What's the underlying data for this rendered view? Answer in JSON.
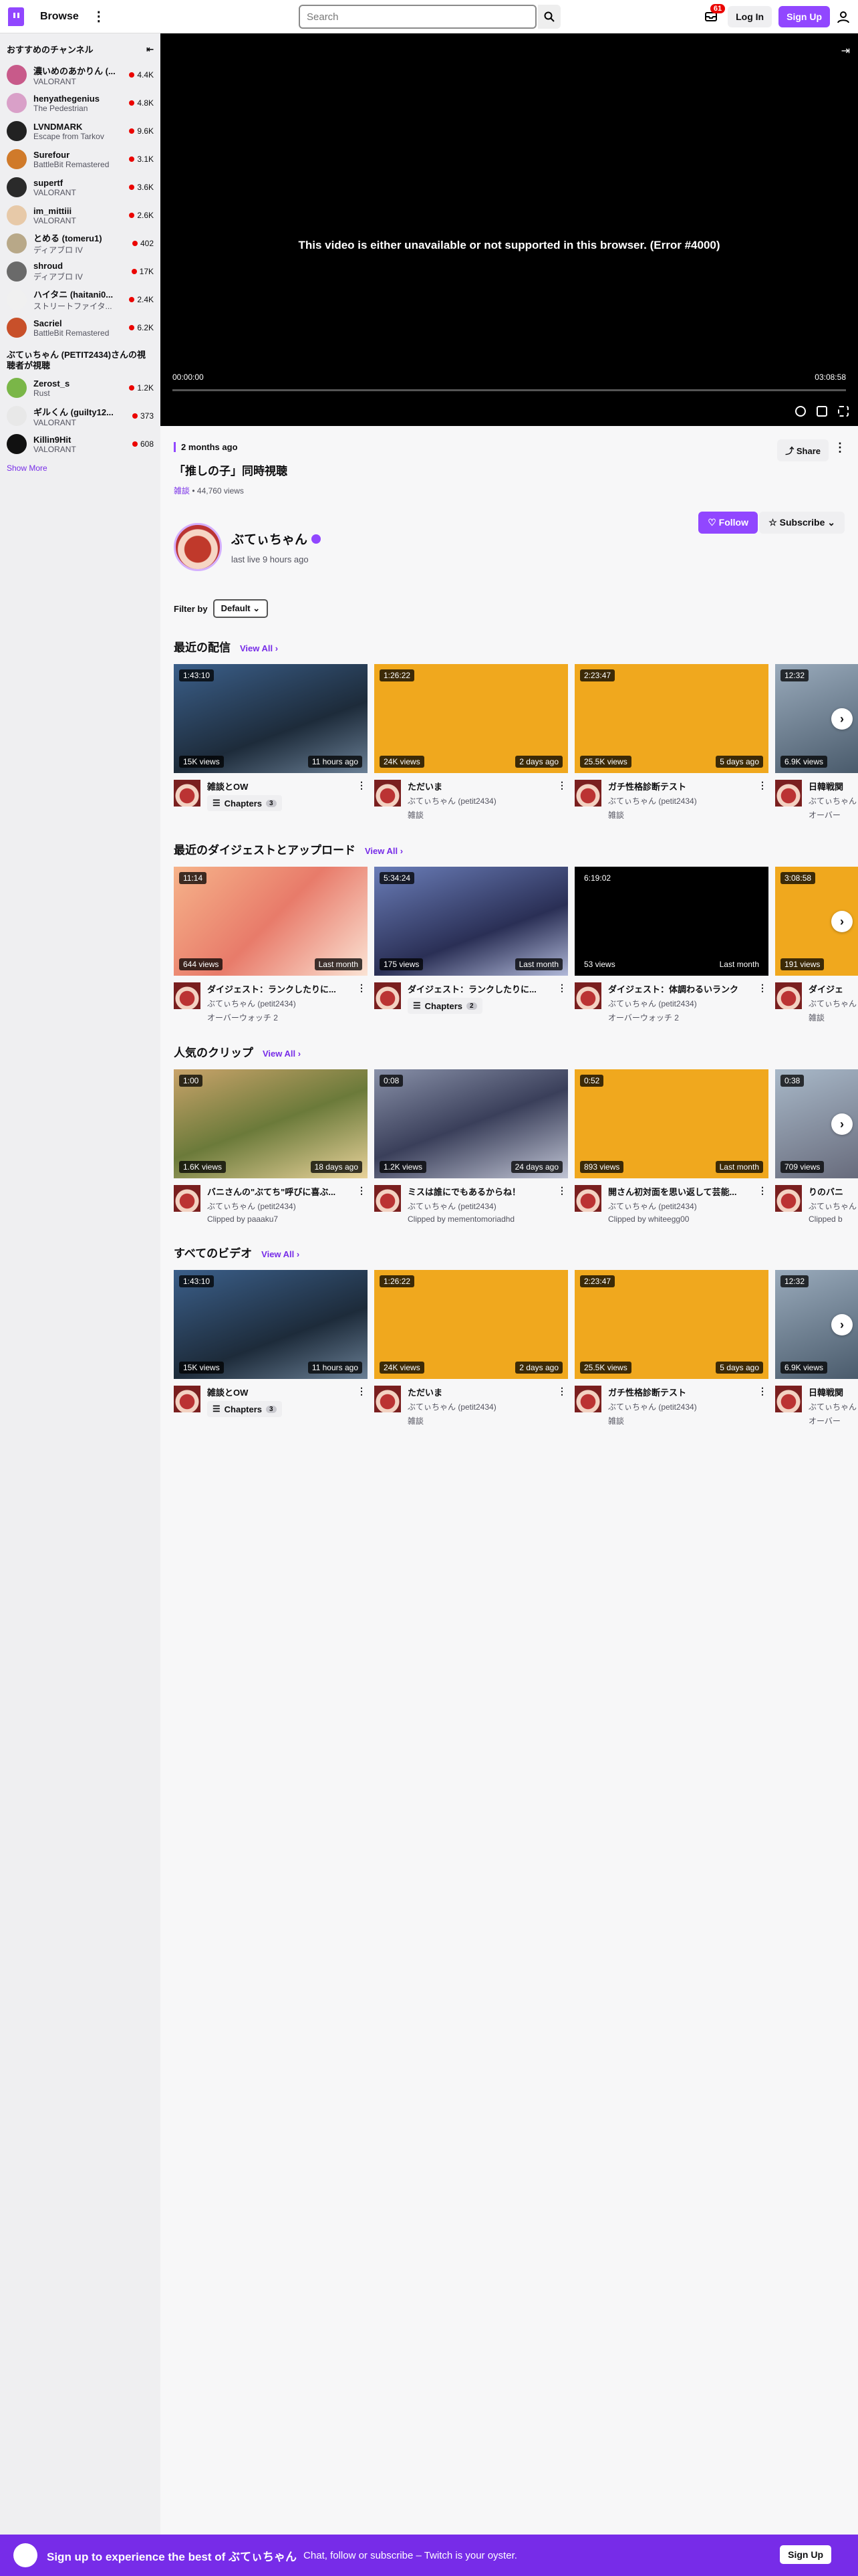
{
  "topbar": {
    "browse": "Browse",
    "search_placeholder": "Search",
    "notifications": "61",
    "login": "Log In",
    "signup": "Sign Up"
  },
  "sidebar": {
    "heading": "おすすめのチャンネル",
    "items": [
      {
        "name": "濃いめのあかりん (...",
        "game": "VALORANT",
        "viewers": "4.4K",
        "color": "#c85a8a"
      },
      {
        "name": "henyathegenius",
        "game": "The Pedestrian",
        "viewers": "4.8K",
        "color": "#d9a0c8"
      },
      {
        "name": "LVNDMARK",
        "game": "Escape from Tarkov",
        "viewers": "9.6K",
        "color": "#222222"
      },
      {
        "name": "Surefour",
        "game": "BattleBit Remastered",
        "viewers": "3.1K",
        "color": "#d07a2a"
      },
      {
        "name": "supertf",
        "game": "VALORANT",
        "viewers": "3.6K",
        "color": "#2a2a2a"
      },
      {
        "name": "im_mittiii",
        "game": "VALORANT",
        "viewers": "2.6K",
        "color": "#e7c9a8"
      },
      {
        "name": "とめる (tomeru1)",
        "game": "ディアブロ IV",
        "viewers": "402",
        "color": "#b8a888"
      },
      {
        "name": "shroud",
        "game": "ディアブロ IV",
        "viewers": "17K",
        "color": "#6a6a6a"
      },
      {
        "name": "ハイタニ (haitani0...",
        "game": "ストリートファイタ...",
        "viewers": "2.4K",
        "color": "#f0f0f0"
      },
      {
        "name": "Sacriel",
        "game": "BattleBit Remastered",
        "viewers": "6.2K",
        "color": "#c8502a"
      }
    ],
    "sub_heading": "ぶてぃちゃん (PETIT2434)さんの視聴者が視聴",
    "sub_items": [
      {
        "name": "Zerost_s",
        "game": "Rust",
        "viewers": "1.2K",
        "color": "#7ab648"
      },
      {
        "name": "ギルくん (guilty12...",
        "game": "VALORANT",
        "viewers": "373",
        "color": "#e8e8e8"
      },
      {
        "name": "Killin9Hit",
        "game": "VALORANT",
        "viewers": "608",
        "color": "#111111"
      }
    ],
    "show_more": "Show More"
  },
  "player": {
    "error": "This video is either unavailable or not supported in this browser. (Error #4000)",
    "time_current": "00:00:00",
    "time_total": "03:08:58"
  },
  "video": {
    "ago": "2 months ago",
    "title": "「推しの子」同時視聴",
    "category": "雑談",
    "views": "44,760 views",
    "share": "Share"
  },
  "channel": {
    "name": "ぶてぃちゃん",
    "last_live": "last live 9 hours ago",
    "follow": "Follow",
    "subscribe": "Subscribe"
  },
  "filter": {
    "label": "Filter by",
    "value": "Default"
  },
  "sections": [
    {
      "title": "最近の配信",
      "view_all": "View All",
      "cards": [
        {
          "top": "1:43:10",
          "views": "15K views",
          "date": "11 hours ago",
          "title": "雑談とOW",
          "sub": "",
          "game": "",
          "chapters": "Chapters",
          "chapters_count": "3",
          "bg": "linear-gradient(160deg,#3b5f8a,#1d2b3a 60%,#6a7f95)"
        },
        {
          "top": "1:26:22",
          "views": "24K views",
          "date": "2 days ago",
          "title": "ただいま",
          "sub": "ぶてぃちゃん (petit2434)",
          "game": "雑談",
          "bg": "#f0a81e"
        },
        {
          "top": "2:23:47",
          "views": "25.5K views",
          "date": "5 days ago",
          "title": "ガチ性格診断テスト",
          "sub": "ぶてぃちゃん (petit2434)",
          "game": "雑談",
          "bg": "#f0a81e"
        },
        {
          "top": "12:32",
          "views": "6.9K views",
          "date": "",
          "title": "日韓戦関",
          "sub": "ぶてぃちゃん",
          "game": "オーバー",
          "bg": "linear-gradient(160deg,#9ab,#345)"
        }
      ]
    },
    {
      "title": "最近のダイジェストとアップロード",
      "view_all": "View All",
      "cards": [
        {
          "top": "11:14",
          "views": "644 views",
          "date": "Last month",
          "title": "ダイジェスト：ランクしたりに...",
          "sub": "ぶてぃちゃん (petit2434)",
          "game": "オーバーウォッチ 2",
          "bg": "linear-gradient(135deg,#f6b38a,#e87b6a 50%,#fbe3d4)"
        },
        {
          "top": "5:34:24",
          "views": "175 views",
          "date": "Last month",
          "title": "ダイジェスト：ランクしたりに...",
          "sub": "",
          "game": "",
          "chapters": "Chapters",
          "chapters_count": "2",
          "bg": "linear-gradient(160deg,#6a7db8,#2a2f55 60%,#b0b8d8)"
        },
        {
          "top": "6:19:02",
          "views": "53 views",
          "date": "Last month",
          "title": "ダイジェスト：体調わるいランク",
          "sub": "ぶてぃちゃん (petit2434)",
          "game": "オーバーウォッチ 2",
          "bg": "#000000"
        },
        {
          "top": "3:08:58",
          "views": "191 views",
          "date": "",
          "title": "ダイジェ",
          "sub": "ぶてぃちゃん",
          "game": "雑談",
          "bg": "#f0a81e"
        }
      ]
    },
    {
      "title": "人気のクリップ",
      "view_all": "View All",
      "cards": [
        {
          "top": "1:00",
          "views": "1.6K views",
          "date": "18 days ago",
          "title": "バニさんの\"ぶてち\"呼びに喜ぶ...",
          "sub": "ぶてぃちゃん (petit2434)",
          "game": "Clipped by paaaku7",
          "bg": "linear-gradient(160deg,#c9a36a,#6b7a3a 50%,#e8d29a)"
        },
        {
          "top": "0:08",
          "views": "1.2K views",
          "date": "24 days ago",
          "title": "ミスは誰にでもあるからね！",
          "sub": "ぶてぃちゃん (petit2434)",
          "game": "Clipped by mementomoriadhd",
          "bg": "linear-gradient(160deg,#8890a8,#3a3f5a 50%,#c0c4d4)"
        },
        {
          "top": "0:52",
          "views": "893 views",
          "date": "Last month",
          "title": "開さん初対面を思い返して芸能...",
          "sub": "ぶてぃちゃん (petit2434)",
          "game": "Clipped by whiteegg00",
          "bg": "#f0a81e"
        },
        {
          "top": "0:38",
          "views": "709 views",
          "date": "",
          "title": "りのバニ",
          "sub": "ぶてぃちゃん",
          "game": "Clipped b",
          "bg": "linear-gradient(160deg,#a8b8c8,#556)"
        }
      ]
    },
    {
      "title": "すべてのビデオ",
      "view_all": "View All",
      "cards": [
        {
          "top": "1:43:10",
          "views": "15K views",
          "date": "11 hours ago",
          "title": "雑談とOW",
          "sub": "",
          "game": "",
          "chapters": "Chapters",
          "chapters_count": "3",
          "bg": "linear-gradient(160deg,#3b5f8a,#1d2b3a 60%,#6a7f95)"
        },
        {
          "top": "1:26:22",
          "views": "24K views",
          "date": "2 days ago",
          "title": "ただいま",
          "sub": "ぶてぃちゃん (petit2434)",
          "game": "雑談",
          "bg": "#f0a81e"
        },
        {
          "top": "2:23:47",
          "views": "25.5K views",
          "date": "5 days ago",
          "title": "ガチ性格診断テスト",
          "sub": "ぶてぃちゃん (petit2434)",
          "game": "雑談",
          "bg": "#f0a81e"
        },
        {
          "top": "12:32",
          "views": "6.9K views",
          "date": "",
          "title": "日韓戦関",
          "sub": "ぶてぃちゃん",
          "game": "オーバー",
          "bg": "linear-gradient(160deg,#9ab,#345)"
        }
      ]
    }
  ],
  "banner": {
    "text": "Sign up to experience the best of ぶてぃちゃん",
    "sub": "Chat, follow or subscribe – Twitch is your oyster.",
    "button": "Sign Up"
  },
  "colors": {
    "brand": "#9147ff",
    "live": "#eb0400",
    "accent_text": "#772ce8"
  }
}
